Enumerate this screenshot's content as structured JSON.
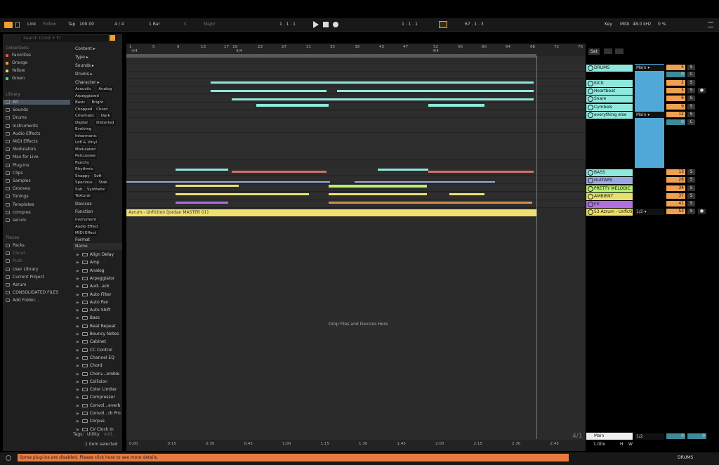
{
  "toolbar": {
    "link": "Link",
    "follow": "Follow",
    "tap": "Tap",
    "tempo": "100.00",
    "meter": "4 / 4",
    "quantize": "1 Bar",
    "key_root": "C",
    "scale": "Major",
    "position": "1 .  1 .  1",
    "loop_start": "1 .  1 .  1",
    "loop_length": "67 .  1 .  3",
    "key": "Key",
    "midi": "MIDI",
    "sample_rate": "48.0 kHz",
    "cpu": "0 %"
  },
  "browser": {
    "search_placeholder": "Search (Cmd + F)",
    "collections_header": "Collections",
    "collections": [
      {
        "label": "Favorites",
        "color": "#e85050"
      },
      {
        "label": "Orange",
        "color": "#f0a030"
      },
      {
        "label": "Yellow",
        "color": "#e8e050"
      },
      {
        "label": "Green",
        "color": "#50d070"
      }
    ],
    "library_header": "Library",
    "library": [
      "All",
      "Sounds",
      "Drums",
      "Instruments",
      "Audio Effects",
      "MIDI Effects",
      "Modulators",
      "Max for Live",
      "Plug-Ins",
      "Clips",
      "Samples",
      "Grooves",
      "Tunings",
      "Templates",
      "compres",
      "serum"
    ],
    "places_header": "Places",
    "places": [
      "Packs",
      "Cloud",
      "Push",
      "User Library",
      "Current Project",
      "Azrum",
      "CONSOLIDATED FILES",
      "Add Folder..."
    ],
    "filters": [
      "Content",
      "Type",
      "Sounds",
      "Drums",
      "Character"
    ],
    "character_tags": [
      [
        "Acoustic",
        "Analog"
      ],
      [
        "Arpeggiated"
      ],
      [
        "Basic",
        "Bright"
      ],
      [
        "Chopped",
        "Chord"
      ],
      [
        "Cinematic",
        "Dark"
      ],
      [
        "Digital",
        "Distorted"
      ],
      [
        "Evolving"
      ],
      [
        "Inharmonic"
      ],
      [
        "Lofi & Vinyl"
      ],
      [
        "Modulated"
      ],
      [
        "Percussive"
      ],
      [
        "Punchy"
      ],
      [
        "Rhythmic"
      ],
      [
        "Snappy",
        "Soft"
      ],
      [
        "Spacious",
        "Stab"
      ],
      [
        "Sub",
        "Synthetic"
      ],
      [
        "Textural"
      ]
    ],
    "devices_label": "Devices",
    "function_label": "Function",
    "function_tags": [
      "Instrument",
      "Audio Effect",
      "MIDI Effect"
    ],
    "format_label": "Format",
    "name_header": "Name",
    "items": [
      "Align Delay",
      "Amp",
      "Analog",
      "Arpeggiator",
      "Aud...ack",
      "Auto Filter",
      "Auto Pan",
      "Auto Shift",
      "Bass",
      "Beat Repeat",
      "Bouncy Notes",
      "Cabinet",
      "CC Control",
      "Channel EQ",
      "Chord",
      "Choru...emble",
      "Collision",
      "Color Limiter",
      "Compressor",
      "Convol...everb",
      "Convol...rb Pro",
      "Corpus",
      "CV Clock In"
    ],
    "tags_label": "Tags:",
    "tags_utility": "Utility",
    "tags_add": "Add...",
    "selected_info": "1 item selected"
  },
  "arrangement": {
    "bars": [
      "1",
      "5",
      "9",
      "13",
      "17",
      "19",
      "23",
      "27",
      "31",
      "35",
      "39",
      "43",
      "47",
      "52",
      "56",
      "60",
      "64",
      "68",
      "72",
      "76"
    ],
    "sig1": "4/4",
    "sig2": "4/4",
    "sig3": "4/4",
    "audio_clip": "Azrum - Unfiction (Jordan MASTER 01)",
    "drop_text": "Drop Files and Devices Here",
    "times": [
      "0:00",
      "0:15",
      "0:30",
      "0:45",
      "1:00",
      "1:15",
      "1:30",
      "1:45",
      "2:00",
      "2:15",
      "2:30",
      "2:45"
    ]
  },
  "mixer": {
    "set_label": "Set",
    "tracks": [
      {
        "name": "DRUMS",
        "color": "#8fe8dc",
        "vol": "5",
        "route": "Main"
      },
      {
        "name": "",
        "color": "#8fe8dc",
        "vol": "0"
      },
      {
        "name": "KICK",
        "color": "#8fe8dc",
        "vol": "2"
      },
      {
        "name": "Heartbeat",
        "color": "#8fe8dc",
        "vol": "5"
      },
      {
        "name": "Snare",
        "color": "#8fe8dc",
        "vol": "6"
      },
      {
        "name": "Cymbals",
        "color": "#8fe8dc",
        "vol": "9"
      },
      {
        "name": "everything else",
        "color": "#8fe8dc",
        "vol": "12",
        "route": "Main"
      },
      {
        "name": "",
        "color": "#8fe8dc",
        "vol": "0"
      },
      {
        "name": "BASS",
        "color": "#8fe8dc",
        "vol": "13"
      },
      {
        "name": "GUITARS",
        "color": "#9aa8e0",
        "vol": "28"
      },
      {
        "name": "PRETTY MELODIC",
        "color": "#b8f070",
        "vol": "34"
      },
      {
        "name": "AMBIENT",
        "color": "#e8e070",
        "vol": "37"
      },
      {
        "name": "FX",
        "color": "#b070e0",
        "vol": "41"
      },
      {
        "name": "53 Azrum - Unficti",
        "color": "#f0e060",
        "vol": "53",
        "route": "1/2"
      }
    ],
    "main": "Main",
    "main_route": "1/2",
    "main_vol": "0",
    "main_vol2": "0",
    "sig": "4/1",
    "zoom": "1.00x",
    "h": "H",
    "w": "W"
  },
  "status": {
    "message": "Some plug-ins are disabled. Please click here to see more details.",
    "track": "DRUMS"
  }
}
